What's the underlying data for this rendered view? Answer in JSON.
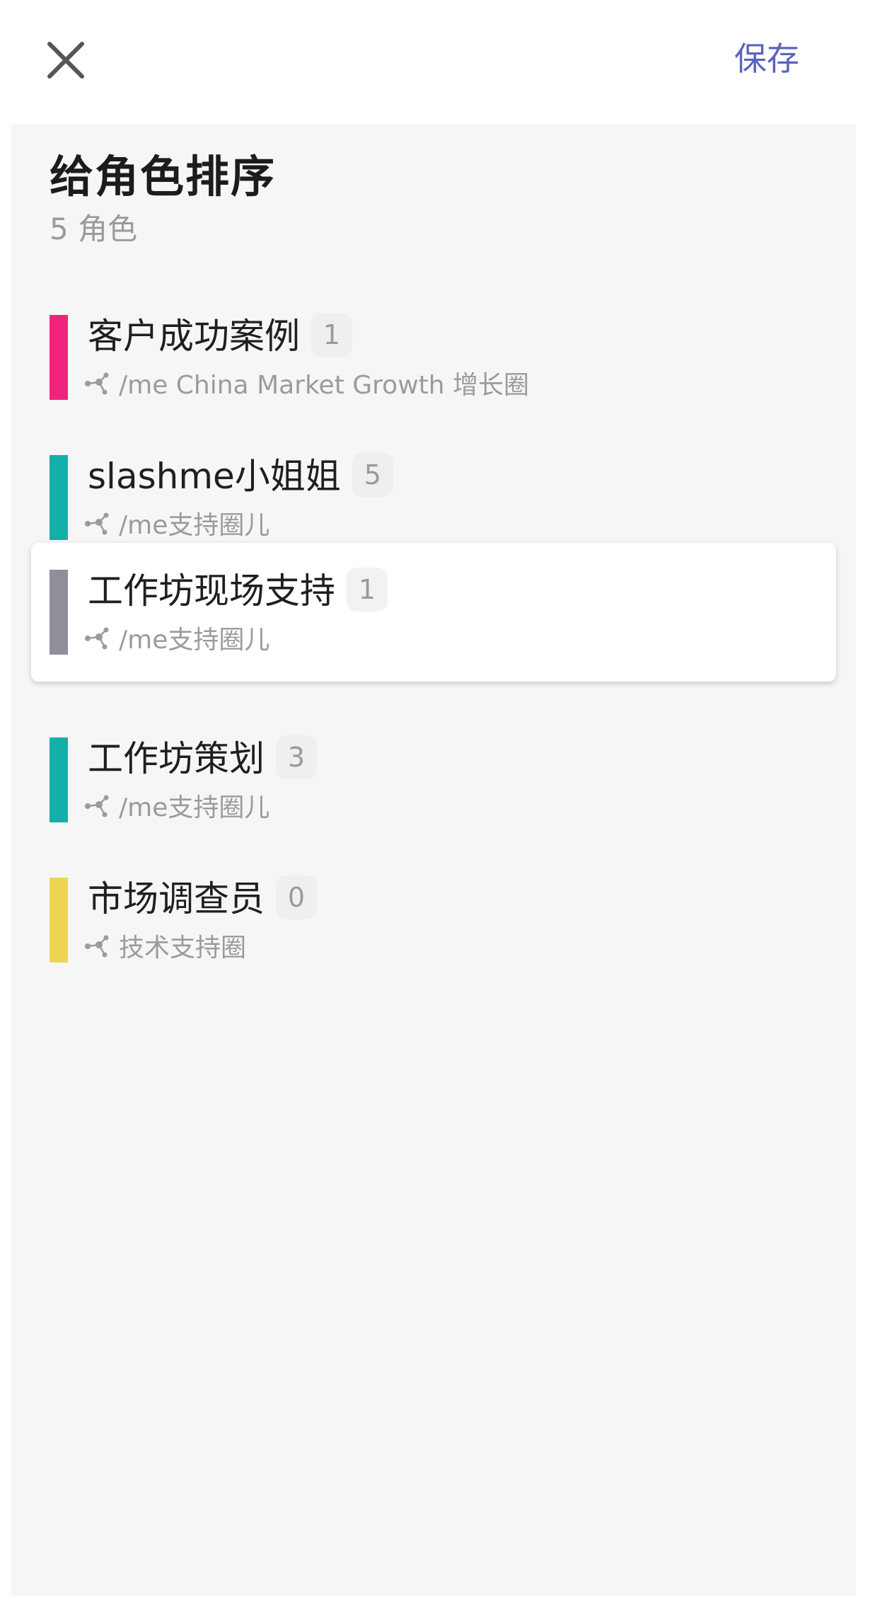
{
  "header": {
    "close_icon": "close-icon",
    "save_label": "保存",
    "accent_color": "#5c63bf"
  },
  "page": {
    "title": "给角色排序",
    "subtitle": "5 角色"
  },
  "roles": [
    {
      "name": "客户成功案例",
      "count": "1",
      "circle": "/me China Market Growth 增长圈",
      "color": "#f0237a",
      "icon": "circle-network-icon"
    },
    {
      "name": "slashme小姐姐",
      "count": "5",
      "circle": "/me支持圈儿",
      "color": "#14b0a8",
      "icon": "circle-network-icon"
    },
    {
      "name": "工作坊现场支持",
      "count": "1",
      "circle": "/me支持圈儿",
      "color": "#8f8f9c",
      "icon": "circle-network-icon",
      "state": "dragging"
    },
    {
      "name": "工作坊策划",
      "count": "3",
      "circle": "/me支持圈儿",
      "color": "#14b0a8",
      "icon": "circle-network-icon"
    },
    {
      "name": "市场调查员",
      "count": "0",
      "circle": "技术支持圈",
      "color": "#ecd651",
      "icon": "circle-network-icon"
    }
  ]
}
